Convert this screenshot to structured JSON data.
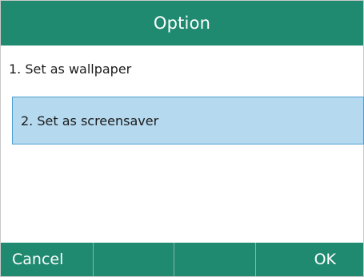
{
  "header": {
    "title": "Option"
  },
  "menu": {
    "items": [
      {
        "label": "1. Set as wallpaper",
        "selected": false
      },
      {
        "label": "2. Set as screensaver",
        "selected": true
      }
    ]
  },
  "softkeys": [
    {
      "label": "Cancel"
    },
    {
      "label": ""
    },
    {
      "label": ""
    },
    {
      "label": "OK"
    }
  ],
  "colors": {
    "accent": "#1f8a70",
    "selection_fill": "#b5d9ef",
    "selection_border": "#4b9fd0"
  }
}
